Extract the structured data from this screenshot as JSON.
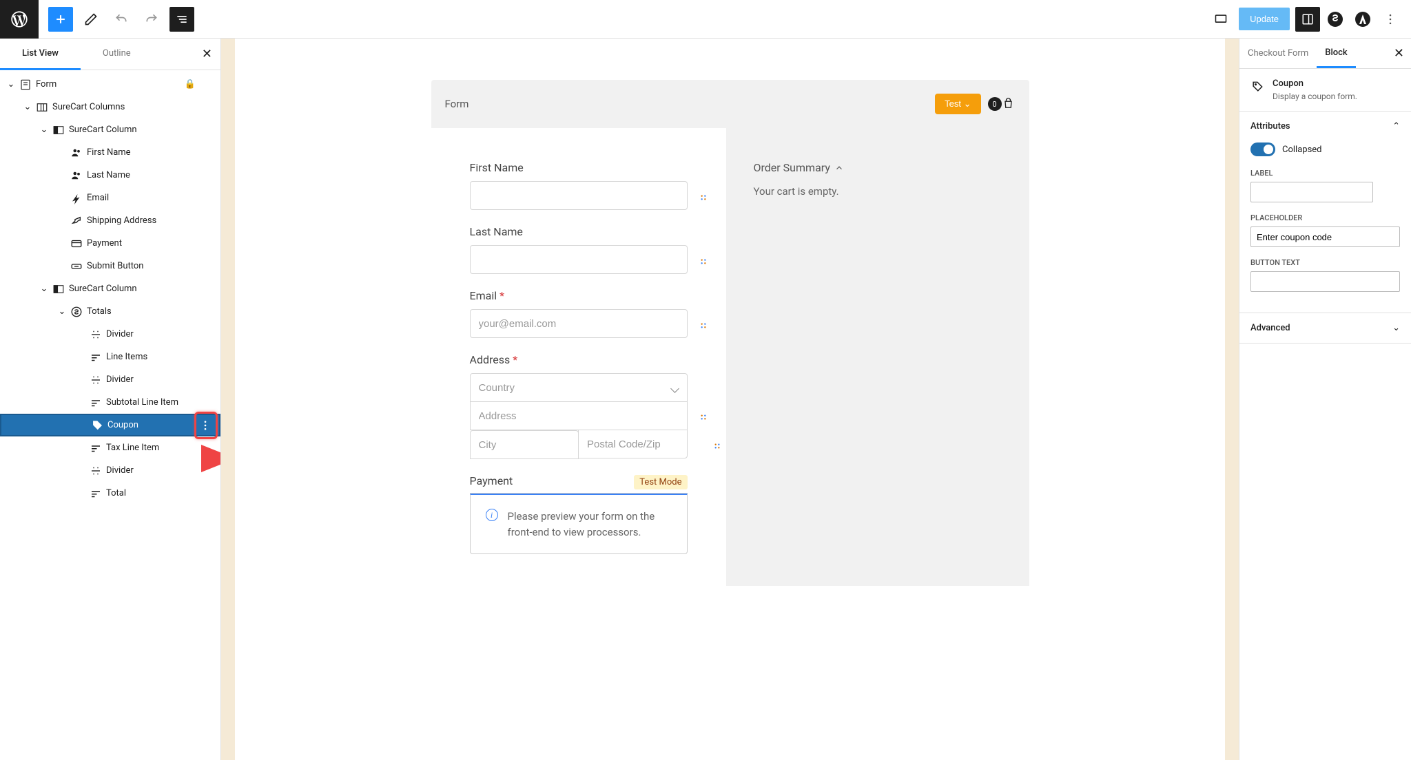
{
  "topbar": {
    "update_label": "Update"
  },
  "left_panel": {
    "tabs": {
      "list_view": "List View",
      "outline": "Outline"
    },
    "tree": {
      "form": "Form",
      "surecart_columns": "SureCart Columns",
      "col1": "SureCart Column",
      "first_name": "First Name",
      "last_name": "Last Name",
      "email": "Email",
      "shipping_address": "Shipping Address",
      "payment": "Payment",
      "submit_button": "Submit Button",
      "col2": "SureCart Column",
      "totals": "Totals",
      "divider1": "Divider",
      "line_items": "Line Items",
      "divider2": "Divider",
      "subtotal": "Subtotal Line Item",
      "coupon": "Coupon",
      "tax": "Tax Line Item",
      "divider3": "Divider",
      "total": "Total"
    }
  },
  "canvas": {
    "form_title": "Form",
    "test_btn": "Test",
    "cart_count": "0",
    "first_name_label": "First Name",
    "last_name_label": "Last Name",
    "email_label": "Email",
    "email_placeholder": "your@email.com",
    "address_label": "Address",
    "country_placeholder": "Country",
    "address_placeholder": "Address",
    "city_placeholder": "City",
    "postal_placeholder": "Postal Code/Zip",
    "payment_label": "Payment",
    "test_mode_badge": "Test Mode",
    "payment_msg": "Please preview your form on the front-end to view processors.",
    "summary_title": "Order Summary",
    "summary_empty": "Your cart is empty."
  },
  "right_panel": {
    "tabs": {
      "checkout_form": "Checkout Form",
      "block": "Block"
    },
    "block_title": "Coupon",
    "block_desc": "Display a coupon form.",
    "attributes_section": "Attributes",
    "collapsed_label": "Collapsed",
    "label_label": "LABEL",
    "placeholder_label": "PLACEHOLDER",
    "placeholder_value": "Enter coupon code",
    "button_text_label": "BUTTON TEXT",
    "advanced_section": "Advanced"
  }
}
